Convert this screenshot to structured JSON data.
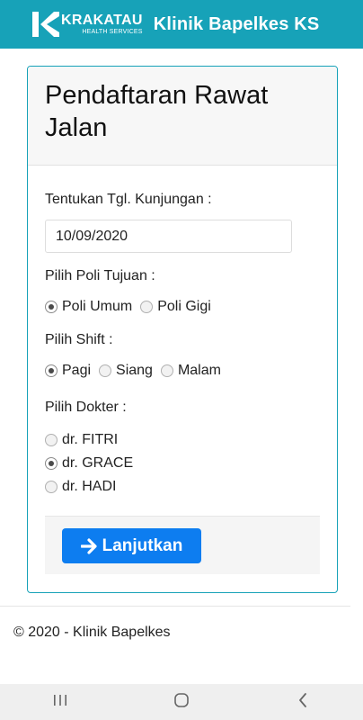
{
  "header": {
    "brand_name": "KRAKATAU",
    "brand_sub": "HEALTH SERVICES",
    "title": "Klinik Bapelkes KS",
    "brand_color": "#17a2b8"
  },
  "form": {
    "title": "Pendaftaran Rawat Jalan",
    "date_label": "Tentukan Tgl. Kunjungan :",
    "date_value": "10/09/2020",
    "poli_label": "Pilih Poli Tujuan :",
    "poli_options": [
      {
        "label": "Poli Umum",
        "checked": true
      },
      {
        "label": "Poli Gigi",
        "checked": false
      }
    ],
    "shift_label": "Pilih Shift :",
    "shift_options": [
      {
        "label": "Pagi",
        "checked": true
      },
      {
        "label": "Siang",
        "checked": false
      },
      {
        "label": "Malam",
        "checked": false
      }
    ],
    "doctor_label": "Pilih Dokter :",
    "doctor_options": [
      {
        "label": "dr. FITRI",
        "checked": false
      },
      {
        "label": "dr. GRACE",
        "checked": true
      },
      {
        "label": "dr. HADI",
        "checked": false
      }
    ],
    "submit_label": "Lanjutkan",
    "submit_icon": "arrow-right-icon",
    "button_color": "#0d7df0"
  },
  "footer": {
    "copyright": "© 2020 - Klinik Bapelkes"
  },
  "system_nav": {
    "recent_icon": "recent-apps-icon",
    "home_icon": "home-icon",
    "back_icon": "back-icon"
  }
}
